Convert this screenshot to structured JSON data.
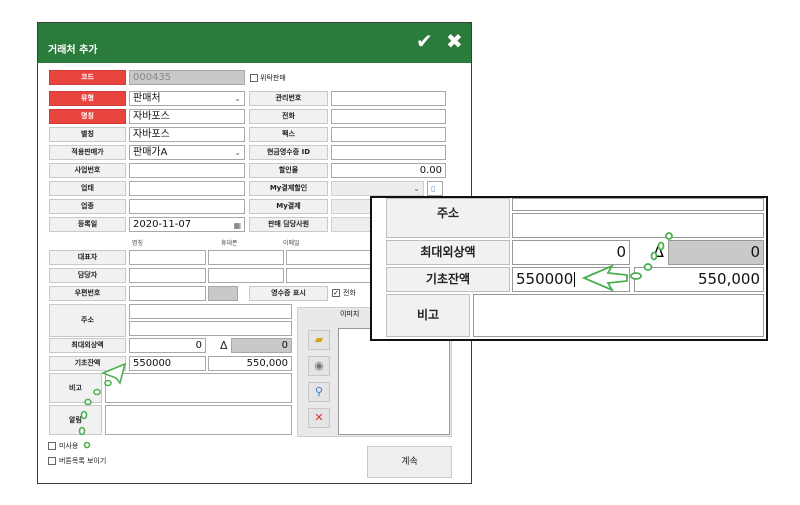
{
  "window": {
    "title": "거래처 추가",
    "confirm_icon": "check-icon",
    "close_icon": "close-x-icon"
  },
  "form": {
    "code": {
      "label": "코드",
      "value": "000435"
    },
    "consign_sale": {
      "label": "위탁판매",
      "checked": false
    },
    "type": {
      "label": "유형",
      "value": "판매처"
    },
    "manage_no": {
      "label": "관리번호",
      "value": ""
    },
    "name": {
      "label": "명칭",
      "value": "자바포스"
    },
    "phone": {
      "label": "전화",
      "value": ""
    },
    "alias": {
      "label": "별칭",
      "value": "자바포스"
    },
    "fax": {
      "label": "팩스",
      "value": ""
    },
    "price_tier": {
      "label": "적용판매가",
      "value": "판매가A"
    },
    "cash_receipt_id": {
      "label": "현금영수증 ID",
      "value": ""
    },
    "biz_no": {
      "label": "사업번호",
      "value": ""
    },
    "discount_rate": {
      "label": "할인율",
      "value": "0.00"
    },
    "biz_type": {
      "label": "업태",
      "value": ""
    },
    "my_pay_discount": {
      "label": "My결제할인",
      "value": ""
    },
    "biz_item": {
      "label": "업종",
      "value": ""
    },
    "my_pay": {
      "label": "My결제",
      "value": ""
    },
    "reg_date": {
      "label": "등록일",
      "value": "2020-11-07",
      "calendar_icon": "calendar-icon"
    },
    "sales_rep": {
      "label": "판매 담당사원",
      "value": ""
    },
    "col_headers": {
      "name": "명칭",
      "mobile": "휴대폰",
      "email": "이메일"
    },
    "ceo": {
      "label": "대표자"
    },
    "manager": {
      "label": "담당자"
    },
    "zip": {
      "label": "우편번호"
    },
    "receipt_show": {
      "label": "영수증 표시",
      "phone_label": "전화",
      "phone_checked": true
    },
    "address": {
      "label": "주소"
    },
    "max_credit": {
      "label": "최대외상액",
      "value": "0",
      "delta": "Δ",
      "computed": "0"
    },
    "opening_balance": {
      "label": "기초잔액",
      "value": "550000",
      "computed": "550,000"
    },
    "memo": {
      "label": "비고"
    },
    "alarm": {
      "label": "알림"
    },
    "unused": {
      "label": "미사용",
      "checked": false
    },
    "show_buttons": {
      "label": "버튼목록 보이기",
      "checked": false
    },
    "image_header": "이미지",
    "continue_button": "계속"
  },
  "zoom": {
    "address_label": "주소",
    "max_credit_label": "최대외상액",
    "max_credit_value": "0",
    "delta": "Δ",
    "max_credit_computed": "0",
    "opening_label": "기초잔액",
    "opening_value": "550000",
    "opening_computed": "550,000",
    "memo_label": "비고"
  },
  "colors": {
    "titlebar": "#2b7b3b",
    "required_label": "#e8453f",
    "annotation_arrow": "#4caf50"
  }
}
